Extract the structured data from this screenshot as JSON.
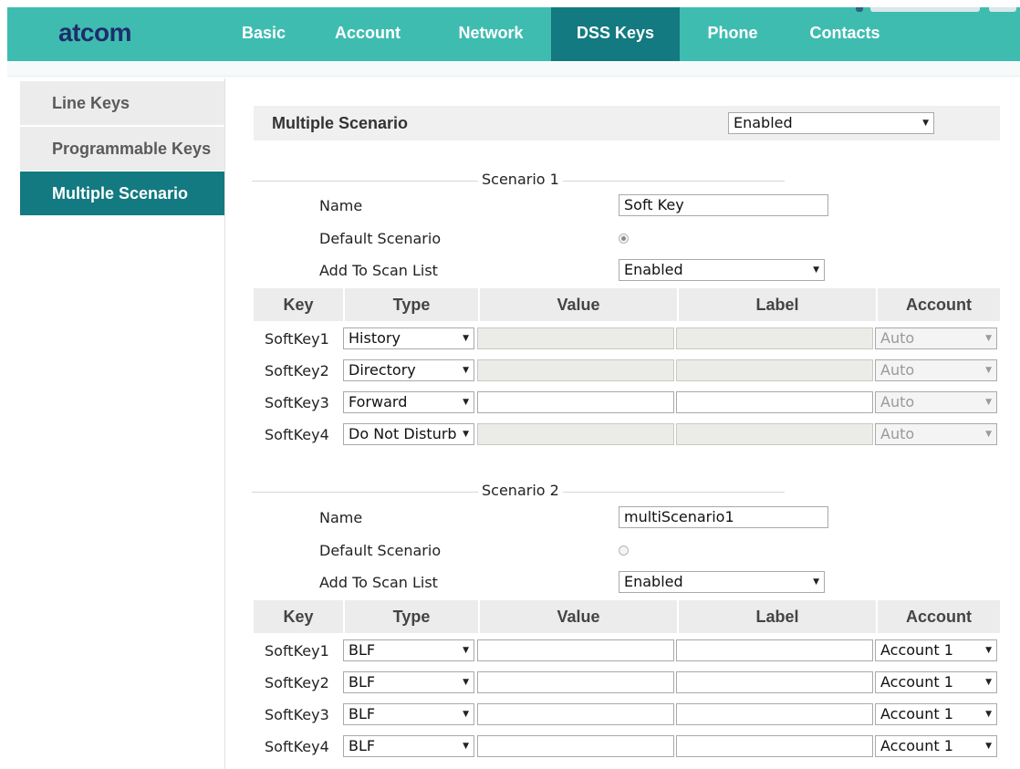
{
  "header": {
    "logo": "atcom",
    "nav": [
      {
        "label": "Basic"
      },
      {
        "label": "Account"
      },
      {
        "label": "Network"
      },
      {
        "label": "DSS Keys",
        "active": true
      },
      {
        "label": "Phone"
      },
      {
        "label": "Contacts"
      }
    ]
  },
  "sidebar": {
    "items": [
      {
        "label": "Line Keys"
      },
      {
        "label": "Programmable Keys"
      },
      {
        "label": "Multiple Scenario",
        "active": true
      }
    ]
  },
  "main": {
    "multiple_scenario": {
      "label": "Multiple Scenario",
      "value": "Enabled"
    },
    "columns": [
      "Key",
      "Type",
      "Value",
      "Label",
      "Account"
    ],
    "scenarios": [
      {
        "legend": "Scenario 1",
        "name_label": "Name",
        "name_value": "Soft Key",
        "default_label": "Default Scenario",
        "default_checked": true,
        "scan_label": "Add To Scan List",
        "scan_value": "Enabled",
        "rows": [
          {
            "key": "SoftKey1",
            "type": "History",
            "value": "",
            "label": "",
            "account": "Auto",
            "value_disabled": true,
            "label_disabled": true,
            "account_disabled": true
          },
          {
            "key": "SoftKey2",
            "type": "Directory",
            "value": "",
            "label": "",
            "account": "Auto",
            "value_disabled": true,
            "label_disabled": true,
            "account_disabled": true
          },
          {
            "key": "SoftKey3",
            "type": "Forward",
            "value": "",
            "label": "",
            "account": "Auto",
            "value_disabled": false,
            "label_disabled": false,
            "account_disabled": true
          },
          {
            "key": "SoftKey4",
            "type": "Do Not Disturb",
            "value": "",
            "label": "",
            "account": "Auto",
            "value_disabled": true,
            "label_disabled": true,
            "account_disabled": true
          }
        ]
      },
      {
        "legend": "Scenario 2",
        "name_label": "Name",
        "name_value": "multiScenario1",
        "default_label": "Default Scenario",
        "default_checked": false,
        "scan_label": "Add To Scan List",
        "scan_value": "Enabled",
        "rows": [
          {
            "key": "SoftKey1",
            "type": "BLF",
            "value": "",
            "label": "",
            "account": "Account 1",
            "value_disabled": false,
            "label_disabled": false,
            "account_disabled": false
          },
          {
            "key": "SoftKey2",
            "type": "BLF",
            "value": "",
            "label": "",
            "account": "Account 1",
            "value_disabled": false,
            "label_disabled": false,
            "account_disabled": false
          },
          {
            "key": "SoftKey3",
            "type": "BLF",
            "value": "",
            "label": "",
            "account": "Account 1",
            "value_disabled": false,
            "label_disabled": false,
            "account_disabled": false
          },
          {
            "key": "SoftKey4",
            "type": "BLF",
            "value": "",
            "label": "",
            "account": "Account 1",
            "value_disabled": false,
            "label_disabled": false,
            "account_disabled": false
          }
        ]
      }
    ]
  },
  "colors": {
    "header_bg": "#3fbcb0",
    "active_tab": "#127a80",
    "logo": "#1d2e6b",
    "sidebar_bg": "#ececec"
  }
}
